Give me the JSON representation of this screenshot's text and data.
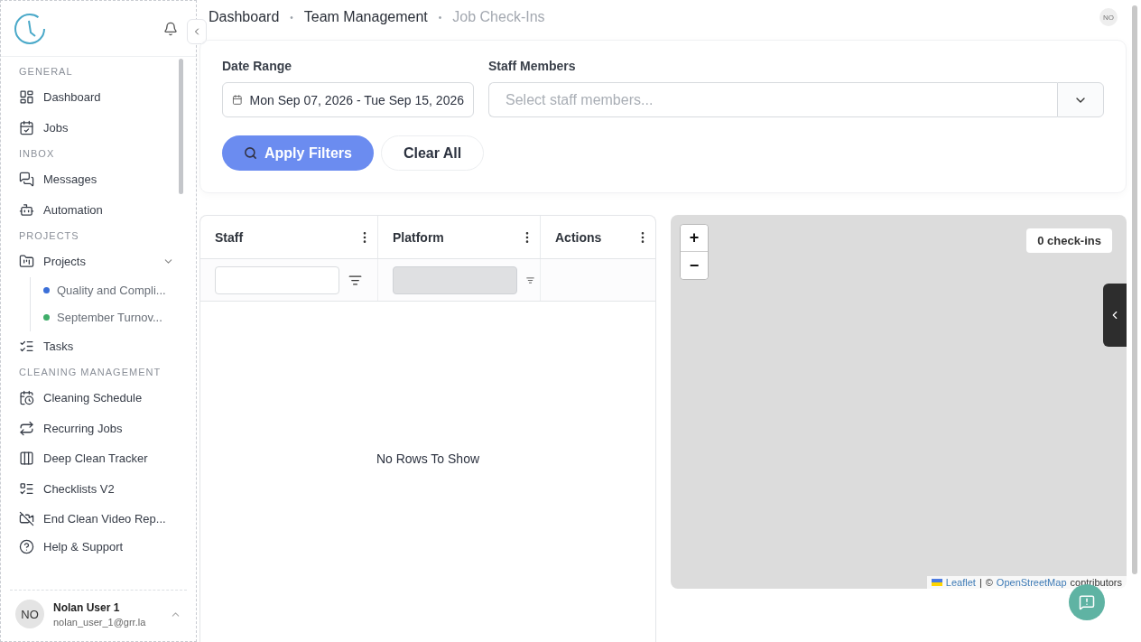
{
  "sidebar": {
    "sections": [
      {
        "label": "GENERAL",
        "items": [
          {
            "label": "Dashboard"
          },
          {
            "label": "Jobs"
          }
        ]
      },
      {
        "label": "INBOX",
        "items": [
          {
            "label": "Messages"
          },
          {
            "label": "Automation"
          }
        ]
      },
      {
        "label": "PROJECTS",
        "items": [
          {
            "label": "Projects",
            "expanded": true,
            "children": [
              {
                "label": "Quality and Compli...",
                "color": "#3b6fd8"
              },
              {
                "label": "September Turnov...",
                "color": "#3fae6a"
              }
            ]
          },
          {
            "label": "Tasks"
          }
        ]
      },
      {
        "label": "CLEANING MANAGEMENT",
        "items": [
          {
            "label": "Cleaning Schedule"
          },
          {
            "label": "Recurring Jobs"
          },
          {
            "label": "Deep Clean Tracker"
          },
          {
            "label": "Checklists V2"
          },
          {
            "label": "End Clean Video Rep..."
          }
        ]
      }
    ],
    "help": "Help & Support",
    "user": {
      "initials": "NO",
      "name": "Nolan User 1",
      "email": "nolan_user_1@grr.la"
    }
  },
  "breadcrumb": [
    {
      "label": "Dashboard",
      "current": false
    },
    {
      "label": "Team Management",
      "current": false
    },
    {
      "label": "Job Check-Ins",
      "current": true
    }
  ],
  "breadcrumb_separator": "•",
  "header_avatar": "NO",
  "filters": {
    "date_label": "Date Range",
    "date_value": "Mon Sep 07, 2026 - Tue Sep 15, 2026",
    "staff_label": "Staff Members",
    "staff_placeholder": "Select staff members...",
    "apply": "Apply Filters",
    "clear": "Clear All"
  },
  "table": {
    "columns": [
      {
        "label": "Staff",
        "filter_disabled": false
      },
      {
        "label": "Platform",
        "filter_disabled": true
      },
      {
        "label": "Actions"
      }
    ],
    "empty": "No Rows To Show"
  },
  "map": {
    "zoom_in": "+",
    "zoom_out": "−",
    "count": "0 check-ins",
    "attribution": {
      "leaflet": "Leaflet",
      "separator": "|",
      "copyright": "©",
      "osm": "OpenStreetMap",
      "suffix": "contributors"
    }
  }
}
